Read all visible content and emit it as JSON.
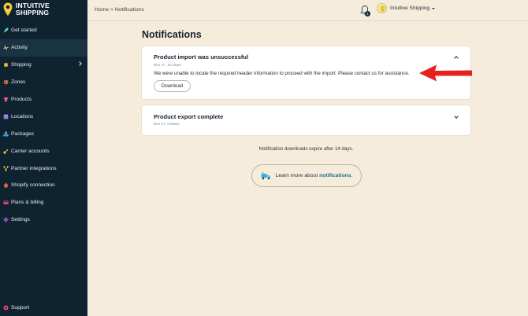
{
  "brand": {
    "line1": "INTUITIVE",
    "line2": "SHIPPING",
    "accent": "#f5d13a"
  },
  "sidebar": {
    "items": [
      {
        "label": "Get started",
        "icon": "rocket-icon",
        "color": "#5fd0e8"
      },
      {
        "label": "Activity",
        "icon": "activity-icon",
        "color": "#e8d06a"
      },
      {
        "label": "Shipping",
        "icon": "shipping-icon",
        "color": "#f5b83a"
      },
      {
        "label": "Zones",
        "icon": "globe-icon",
        "color": "#f07a4a"
      },
      {
        "label": "Products",
        "icon": "tshirt-icon",
        "color": "#ea5b8d"
      },
      {
        "label": "Locations",
        "icon": "store-icon",
        "color": "#9a7ae0"
      },
      {
        "label": "Packages",
        "icon": "boxes-icon",
        "color": "#3fa8e0"
      },
      {
        "label": "Carrier accounts",
        "icon": "key-icon",
        "color": "#e8c24a"
      },
      {
        "label": "Partner integrations",
        "icon": "network-icon",
        "color": "#f5d13a"
      },
      {
        "label": "Shopify connection",
        "icon": "shopify-icon",
        "color": "#ea6a3a"
      },
      {
        "label": "Plans & billing",
        "icon": "card-icon",
        "color": "#e84a6a"
      },
      {
        "label": "Settings",
        "icon": "gear-icon",
        "color": "#c45ae0"
      }
    ],
    "support": {
      "label": "Support",
      "icon": "help-icon",
      "color": "#e84a6a"
    }
  },
  "topbar": {
    "breadcrumb": "Home > Notifications",
    "badge_count": "1",
    "account_name": "Intuitive Shipping"
  },
  "main": {
    "title": "Notifications",
    "notifications": [
      {
        "title": "Product import was unsuccessful",
        "time": "Nov 17, 10:15am",
        "message": "We were unable to locate the required header information to proceed with the import. Please contact us for assistance.",
        "button": "Download"
      },
      {
        "title": "Product export complete",
        "time": "Nov 17, 9:49am"
      }
    ],
    "expire_note": "Notification downloads expire after 14 days.",
    "learn_more": {
      "prefix": "Learn more about ",
      "link": "notifications",
      "suffix": "."
    }
  }
}
